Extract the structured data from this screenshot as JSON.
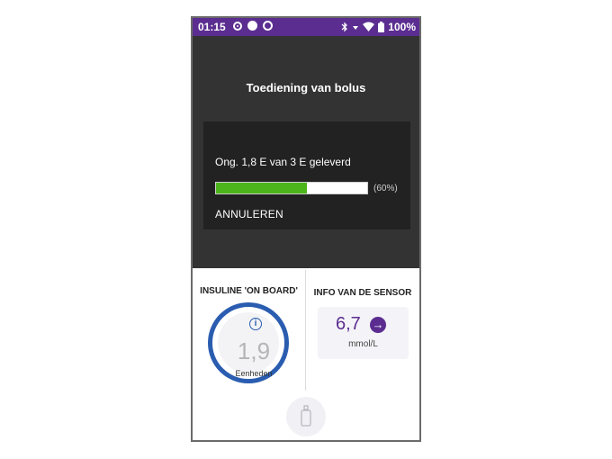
{
  "status_bar": {
    "time": "01:15",
    "battery": "100%",
    "icons": [
      "notification-ring-icon",
      "dot-icon",
      "sync-icon",
      "bluetooth-icon",
      "vibrate-icon",
      "wifi-icon",
      "battery-icon"
    ]
  },
  "colors": {
    "status_bar": "#5b2d90",
    "dark_panel": "#333333",
    "card": "#222222",
    "progress_fill": "#4cb51b",
    "iob_ring": "#2a5db0",
    "accent_purple": "#5b2d90"
  },
  "bolus": {
    "title": "Toediening van bolus",
    "progress_text": "Ong. 1,8 E van 3 E geleverd",
    "progress_fraction": 0.6,
    "progress_pct_label": "(60%)",
    "cancel_label": "ANNULEREN"
  },
  "iob": {
    "label": "INSULINE 'ON BOARD'",
    "value": "1,9",
    "units": "Eenheden"
  },
  "sensor": {
    "label": "INFO VAN DE SENSOR",
    "value": "6,7",
    "unit": "mmol/L"
  }
}
